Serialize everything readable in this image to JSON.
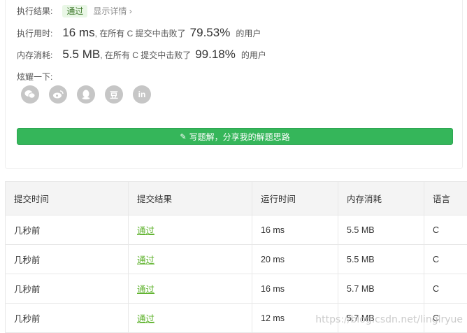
{
  "result": {
    "label": "执行结果:",
    "status": "通过",
    "detail_link": "显示详情 ›"
  },
  "runtime": {
    "label": "执行用时:",
    "value": "16 ms",
    "middle": ", 在所有 C 提交中击败了",
    "percent": "79.53%",
    "suffix": "的用户"
  },
  "memory": {
    "label": "内存消耗:",
    "value": "5.5 MB",
    "middle": ", 在所有 C 提交中击败了",
    "percent": "99.18%",
    "suffix": "的用户"
  },
  "share": {
    "label": "炫耀一下:",
    "icons": [
      "wechat-icon",
      "weibo-icon",
      "qq-icon",
      "douban-icon",
      "linkedin-icon"
    ],
    "douban_glyph": "豆",
    "linkedin_glyph": "in"
  },
  "write_button": {
    "label": "写题解，分享我的解题思路"
  },
  "table": {
    "headers": [
      "提交时间",
      "提交结果",
      "运行时间",
      "内存消耗",
      "语言"
    ],
    "rows": [
      [
        "几秒前",
        "通过",
        "16 ms",
        "5.5 MB",
        "C"
      ],
      [
        "几秒前",
        "通过",
        "20 ms",
        "5.5 MB",
        "C"
      ],
      [
        "几秒前",
        "通过",
        "16 ms",
        "5.7 MB",
        "C"
      ],
      [
        "几秒前",
        "通过",
        "12 ms",
        "5.7 MB",
        "C"
      ]
    ]
  },
  "watermark": "https://blog.csdn.net/linglryue",
  "colors": {
    "accent_green": "#35b65a",
    "pass_link": "#5cb12a",
    "badge_bg": "#e9f7e6"
  }
}
